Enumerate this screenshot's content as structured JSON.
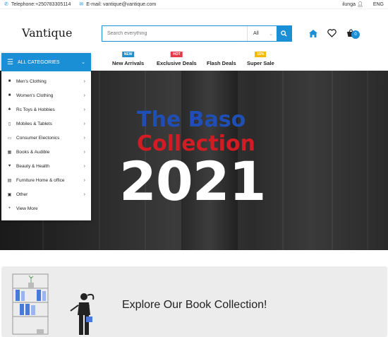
{
  "topbar": {
    "phone": "Telephone:+250783305114",
    "email": "E-mail: vantique@vantique.com",
    "user": "ilunga",
    "lang": "ENG"
  },
  "header": {
    "logo": "Vantique",
    "search_placeholder": "Search everything",
    "search_category": "All",
    "cart_count": "0"
  },
  "nav": {
    "links": [
      {
        "label": "New Arrivals",
        "badge": "NEW",
        "badge_color": "#1a8fd6"
      },
      {
        "label": "Exclusive Deals",
        "badge": "HOT",
        "badge_color": "#e23b4a"
      },
      {
        "label": "Flash Deals",
        "badge": "",
        "badge_color": ""
      },
      {
        "label": "Super Sale",
        "badge": "15%",
        "badge_color": "#f5b800"
      }
    ]
  },
  "categories": {
    "title": "ALL CATEGORIES",
    "items": [
      {
        "label": "Men's Clothing",
        "icon": "shirt-icon"
      },
      {
        "label": "Women's Clothing",
        "icon": "shirt-icon"
      },
      {
        "label": "Rc Toys & Hobbies",
        "icon": "paw-icon"
      },
      {
        "label": "Mobiles & Tablets",
        "icon": "mobile-icon"
      },
      {
        "label": "Consumer Electonics",
        "icon": "laptop-icon"
      },
      {
        "label": "Books & Audible",
        "icon": "book-icon"
      },
      {
        "label": "Beauty & Health",
        "icon": "heart-icon"
      },
      {
        "label": "Furniture Home & office",
        "icon": "bed-icon"
      },
      {
        "label": "Other",
        "icon": "box-icon"
      }
    ],
    "more": "View More"
  },
  "hero": {
    "line1": "The Baso",
    "line2": "Collection",
    "line3": "2021"
  },
  "banner": {
    "text": "Explore Our Book Collection!"
  },
  "colors": {
    "accent": "#1a8fd6",
    "hero_blue": "#1f4fb5",
    "hero_red": "#d11c24"
  }
}
